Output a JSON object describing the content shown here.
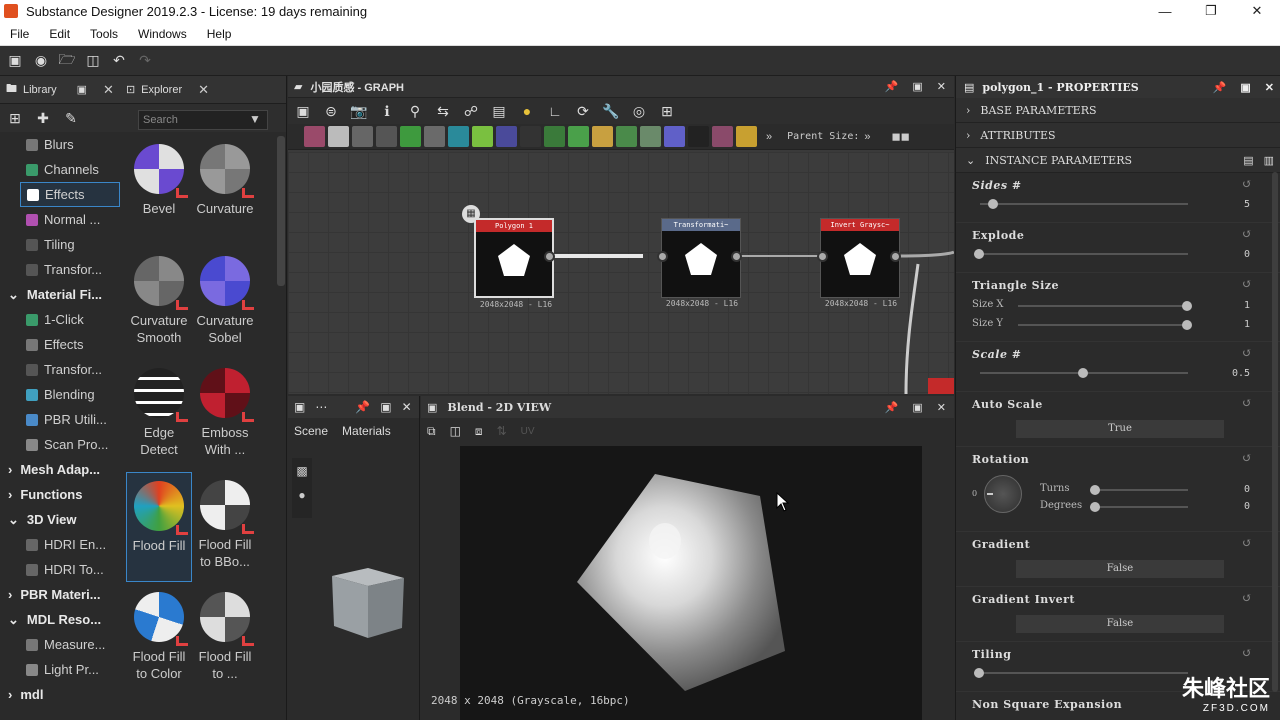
{
  "window": {
    "title": "Substance Designer 2019.2.3 - License: 19 days remaining"
  },
  "menu": [
    "File",
    "Edit",
    "Tools",
    "Windows",
    "Help"
  ],
  "library": {
    "tab_library": "Library",
    "tab_explorer": "Explorer",
    "search_placeholder": "Search",
    "tree": [
      {
        "type": "item",
        "label": "Blurs"
      },
      {
        "type": "item",
        "label": "Channels"
      },
      {
        "type": "item",
        "label": "Effects",
        "selected": true
      },
      {
        "type": "item",
        "label": "Normal ..."
      },
      {
        "type": "item",
        "label": "Tiling"
      },
      {
        "type": "item",
        "label": "Transfor..."
      },
      {
        "type": "cat",
        "label": "Material Fi..."
      },
      {
        "type": "item",
        "label": "1-Click"
      },
      {
        "type": "item",
        "label": "Effects"
      },
      {
        "type": "item",
        "label": "Transfor..."
      },
      {
        "type": "item",
        "label": "Blending"
      },
      {
        "type": "item",
        "label": "PBR Utili..."
      },
      {
        "type": "item",
        "label": "Scan Pro..."
      },
      {
        "type": "cat",
        "label": "Mesh Adap..."
      },
      {
        "type": "cat",
        "label": "Functions"
      },
      {
        "type": "cat",
        "label": "3D View"
      },
      {
        "type": "item",
        "label": "HDRI En..."
      },
      {
        "type": "item",
        "label": "HDRI To..."
      },
      {
        "type": "cat",
        "label": "PBR Materi..."
      },
      {
        "type": "cat",
        "label": "MDL Reso..."
      },
      {
        "type": "item",
        "label": "Measure..."
      },
      {
        "type": "item",
        "label": "Light Pr..."
      },
      {
        "type": "cat",
        "label": "mdl"
      }
    ],
    "thumbs": [
      {
        "label": "Bevel"
      },
      {
        "label": "Curvature"
      },
      {
        "label": "Curvature Smooth"
      },
      {
        "label": "Curvature Sobel"
      },
      {
        "label": "Edge Detect"
      },
      {
        "label": "Emboss With ..."
      },
      {
        "label": "Flood Fill"
      },
      {
        "label": "Flood Fill to BBo..."
      },
      {
        "label": "Flood Fill to Color"
      },
      {
        "label": "Flood Fill to ..."
      }
    ]
  },
  "graph": {
    "title": "小园质感 - GRAPH",
    "parent_size": "Parent Size:",
    "nodes": [
      {
        "name": "Polygon 1",
        "res": "2048x2048 - L16",
        "color": "#c42a2a"
      },
      {
        "name": "Transformati~",
        "res": "2048x2048 - L16",
        "color": "#5a6a8a"
      },
      {
        "name": "Invert Graysc~",
        "res": "2048x2048 - L16",
        "color": "#c42a2a"
      }
    ]
  },
  "view3d": {
    "tab_scene": "Scene",
    "tab_materials": "Materials"
  },
  "view2d": {
    "title": "Blend - 2D VIEW",
    "info": "2048 x 2048 (Grayscale, 16bpc)",
    "uv": "UV"
  },
  "properties": {
    "title": "polygon_1 - PROPERTIES",
    "sec_base": "BASE PARAMETERS",
    "sec_attributes": "ATTRIBUTES",
    "sec_instance": "INSTANCE PARAMETERS",
    "sides_label": "Sides #",
    "sides_value": "5",
    "explode_label": "Explode",
    "explode_value": "0",
    "triangle_label": "Triangle Size",
    "size_x_label": "Size X",
    "size_x_value": "1",
    "size_y_label": "Size Y",
    "size_y_value": "1",
    "scale_label": "Scale #",
    "scale_value": "0.5",
    "autoscale_label": "Auto Scale",
    "autoscale_value": "True",
    "rotation_label": "Rotation",
    "turns_label": "Turns",
    "turns_value": "0",
    "degrees_label": "Degrees",
    "degrees_value": "0",
    "dial_zero": "0",
    "gradient_label": "Gradient",
    "gradient_value": "False",
    "gradinv_label": "Gradient Invert",
    "gradinv_value": "False",
    "tiling_label": "Tiling",
    "nonsquare_label": "Non Square Expansion"
  },
  "watermark": {
    "main": "朱峰社区",
    "sub": "ZF3D.COM"
  }
}
